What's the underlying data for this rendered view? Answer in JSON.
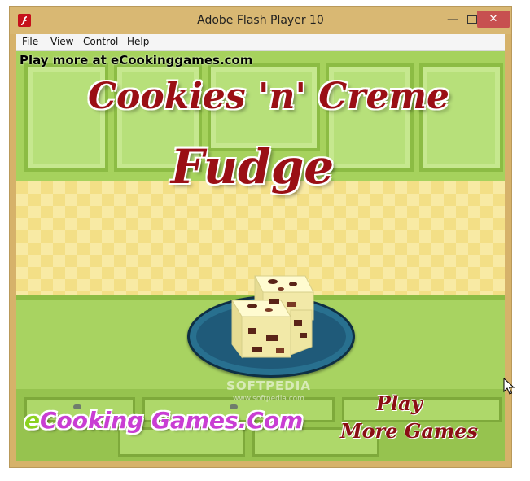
{
  "window": {
    "title": "Adobe Flash Player 10",
    "controls": {
      "minimize": "—",
      "close": "✕"
    }
  },
  "menu": {
    "items": [
      {
        "label": "File"
      },
      {
        "label": "View"
      },
      {
        "label": "Control"
      },
      {
        "label": "Help"
      }
    ]
  },
  "game": {
    "promo_text": "Play more at eCookinggames.com",
    "title_line1": "Cookies 'n' Creme",
    "title_line2": "Fudge",
    "watermark": "SOFTPEDIA",
    "watermark_url": "www.softpedia.com",
    "brand_e": "e",
    "brand_rest": "Cooking Games.Com",
    "play_line1": "Play",
    "play_line2": "More Games"
  },
  "colors": {
    "titlebar": "#d9b873",
    "title_red": "#9a0f15",
    "brand_purple": "#c93ed3",
    "brand_green": "#8bd11f",
    "plate_blue": "#1f5a79",
    "close_red": "#c75050"
  },
  "icons": {
    "app": "flash-icon",
    "cursor": "mouse-pointer-icon"
  }
}
